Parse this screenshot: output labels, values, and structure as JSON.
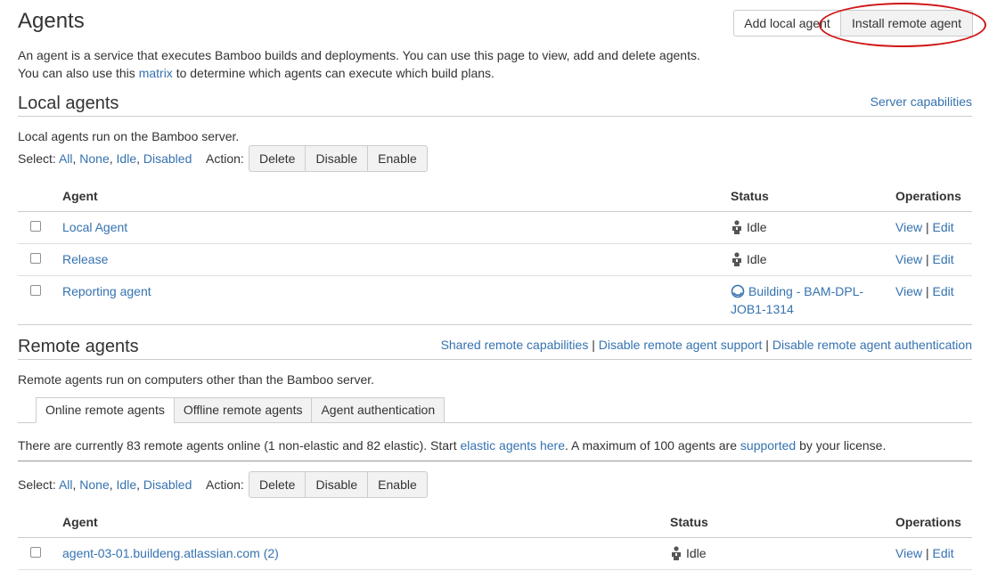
{
  "header": {
    "title": "Agents",
    "add_local_label": "Add local agent",
    "install_remote_label": "Install remote agent"
  },
  "intro": {
    "line1": "An agent is a service that executes Bamboo builds and deployments. You can use this page to view, add and delete agents.",
    "line2_pre": "You can also use this ",
    "line2_link": "matrix",
    "line2_post": " to determine which agents can execute which build plans."
  },
  "local": {
    "heading": "Local agents",
    "server_capabilities": "Server capabilities",
    "description": "Local agents run on the Bamboo server.",
    "select_label": "Select:",
    "select_all": "All",
    "select_none": "None",
    "select_idle": "Idle",
    "select_disabled": "Disabled",
    "action_label": "Action:",
    "delete": "Delete",
    "disable": "Disable",
    "enable": "Enable",
    "col_agent": "Agent",
    "col_status": "Status",
    "col_operations": "Operations",
    "rows": [
      {
        "agent": "Local Agent",
        "status": "Idle",
        "view": "View",
        "edit": "Edit"
      },
      {
        "agent": "Release",
        "status": "Idle",
        "view": "View",
        "edit": "Edit"
      },
      {
        "agent": "Reporting agent",
        "status_line1": "Building - BAM-DPL-",
        "status_line2": "JOB1-1314",
        "view": "View",
        "edit": "Edit"
      }
    ]
  },
  "remote": {
    "heading": "Remote agents",
    "shared_capabilities": "Shared remote capabilities",
    "disable_support": "Disable remote agent support",
    "disable_auth": "Disable remote agent authentication",
    "description": "Remote agents run on computers other than the Bamboo server.",
    "tabs": [
      "Online remote agents",
      "Offline remote agents",
      "Agent authentication"
    ],
    "info_pre": "There are currently 83 remote agents online (1 non-elastic and 82 elastic). Start ",
    "info_link1": "elastic agents here",
    "info_mid": ". A maximum of 100 agents are ",
    "info_link2": "supported",
    "info_post": " by your license.",
    "select_label": "Select:",
    "select_all": "All",
    "select_none": "None",
    "select_idle": "Idle",
    "select_disabled": "Disabled",
    "action_label": "Action:",
    "delete": "Delete",
    "disable": "Disable",
    "enable": "Enable",
    "col_agent": "Agent",
    "col_status": "Status",
    "col_operations": "Operations",
    "rows": [
      {
        "agent": "agent-03-01.buildeng.atlassian.com (2)",
        "status": "Idle",
        "view": "View",
        "edit": "Edit"
      }
    ]
  },
  "colors": {
    "link": "#3572b0",
    "annotation": "#d01515"
  }
}
